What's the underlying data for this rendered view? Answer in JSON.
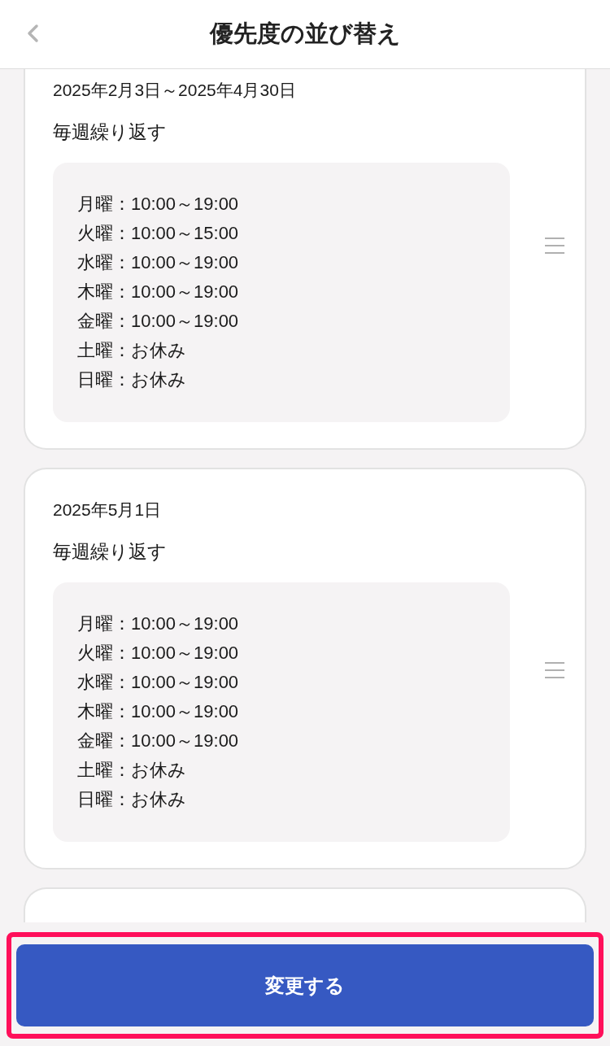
{
  "header": {
    "title": "優先度の並び替え"
  },
  "cards": [
    {
      "date_range": "2025年2月3日～2025年4月30日",
      "repeat": "毎週繰り返す",
      "schedule": [
        "月曜：10:00～19:00",
        "火曜：10:00～15:00",
        "水曜：10:00～19:00",
        "木曜：10:00～19:00",
        "金曜：10:00～19:00",
        "土曜：お休み",
        "日曜：お休み"
      ]
    },
    {
      "date_range": "2025年5月1日",
      "repeat": "毎週繰り返す",
      "schedule": [
        "月曜：10:00～19:00",
        "火曜：10:00～19:00",
        "水曜：10:00～19:00",
        "木曜：10:00～19:00",
        "金曜：10:00～19:00",
        "土曜：お休み",
        "日曜：お休み"
      ]
    }
  ],
  "footer": {
    "button": "変更する"
  }
}
